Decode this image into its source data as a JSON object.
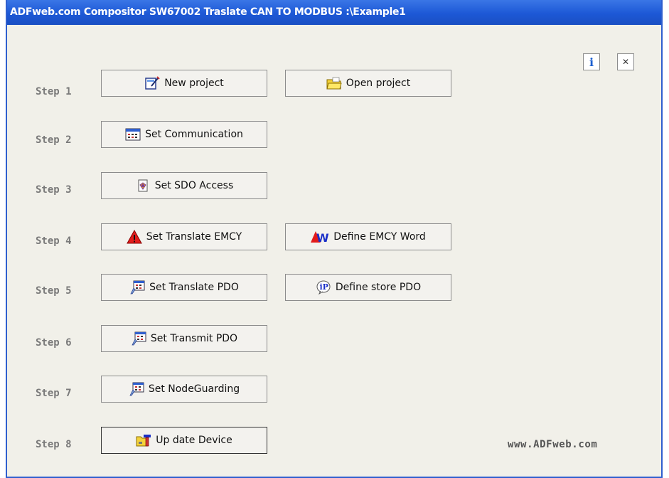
{
  "window": {
    "title": "ADFweb.com Compositor SW67002 Traslate CAN TO MODBUS :\\Example1"
  },
  "top_buttons": {
    "info_label": "i",
    "close_label": "✕"
  },
  "steps": [
    {
      "label": "Step 1"
    },
    {
      "label": "Step 2"
    },
    {
      "label": "Step 3"
    },
    {
      "label": "Step 4"
    },
    {
      "label": "Step 5"
    },
    {
      "label": "Step 6"
    },
    {
      "label": "Step 7"
    },
    {
      "label": "Step 8"
    }
  ],
  "buttons": {
    "new_project": "New project",
    "open_project": "Open project",
    "set_communication": "Set Communication",
    "set_sdo_access": "Set SDO Access",
    "set_translate_emcy": "Set Translate EMCY",
    "define_emcy_word": "Define EMCY Word",
    "set_translate_pdo": "Set Translate PDO",
    "define_store_pdo": "Define store PDO",
    "set_transmit_pdo": "Set Transmit PDO",
    "set_nodeguarding": "Set NodeGuarding",
    "update_device": "Up date Device"
  },
  "icons": {
    "new_project": "new-document-icon",
    "open_project": "open-folder-icon",
    "set_communication": "communication-window-icon",
    "set_sdo_access": "sdo-access-icon",
    "set_translate_emcy": "warning-icon",
    "define_emcy_word": "warning-word-icon",
    "set_translate_pdo": "pdo-table-icon",
    "define_store_pdo": "info-bubble-icon",
    "set_transmit_pdo": "pdo-table-icon",
    "set_nodeguarding": "pdo-table-icon",
    "update_device": "update-device-icon"
  },
  "footer": {
    "website": "www.ADFweb.com"
  },
  "colors": {
    "titlebar": "#1d58d6",
    "background": "#f1f0e9",
    "step_text": "#7a7a7a"
  }
}
